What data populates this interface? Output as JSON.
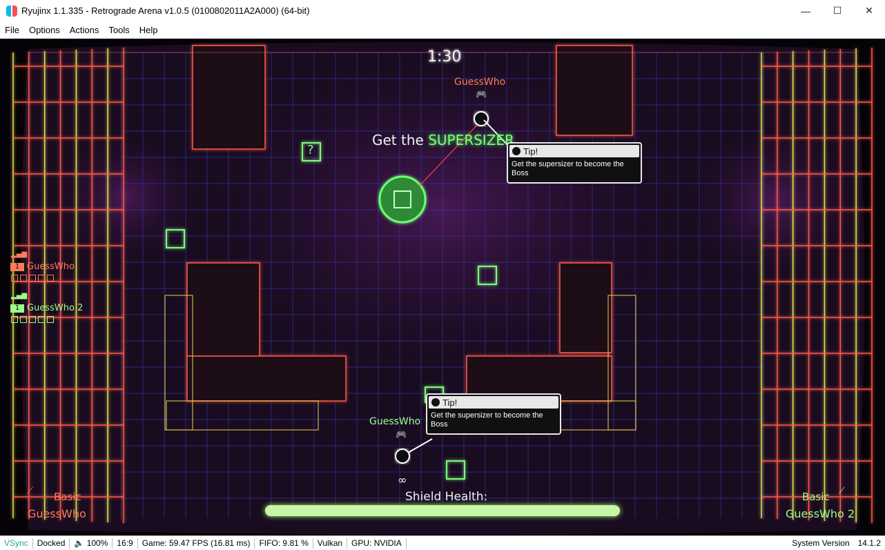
{
  "window": {
    "title": "Ryujinx 1.1.335 - Retrograde Arena v1.0.5 (0100802011A2A000) (64-bit)",
    "controls": {
      "minimize": "—",
      "maximize": "☐",
      "close": "✕"
    }
  },
  "menu": [
    "File",
    "Options",
    "Actions",
    "Tools",
    "Help"
  ],
  "game": {
    "timer": "1:30",
    "banner_prefix": "Get the ",
    "banner_highlight": "SUPERSIZER",
    "player_top": {
      "name": "GuessWho",
      "color": "#ff7b5a"
    },
    "player_bottom": {
      "name": "GuessWho",
      "color": "#9dff8a"
    },
    "bottom_infinity": "∞",
    "tips": [
      {
        "heading": "Tip!",
        "body": "Get the supersizer to become the Boss"
      },
      {
        "heading": "Tip!",
        "body": "Get the supersizer to become the Boss"
      }
    ],
    "scoreboard": [
      {
        "level": "1",
        "name": "GuessWho",
        "color": "#ff7b5a"
      },
      {
        "level": "1",
        "name": "GuessWho 2",
        "color": "#9dff8a"
      }
    ],
    "mystery_icon": "?",
    "shield_label": "Shield Health:",
    "shield_value": 1.0,
    "corner_left": {
      "weapon": "Basic",
      "player": "GuessWho",
      "color": "#ff7b5a"
    },
    "corner_right": {
      "weapon": "Basic",
      "player": "GuessWho 2",
      "color": "#9dff8a"
    }
  },
  "status": {
    "vsync": "VSync",
    "dock": "Docked",
    "volume": "🔈 100%",
    "aspect": "16:9",
    "fps": "Game: 59.47 FPS (16.81 ms)",
    "fifo": "FIFO: 9.81 %",
    "api": "Vulkan",
    "gpu": "GPU: NVIDIA",
    "system_version_label": "System Version",
    "system_version": "14.1.2"
  }
}
